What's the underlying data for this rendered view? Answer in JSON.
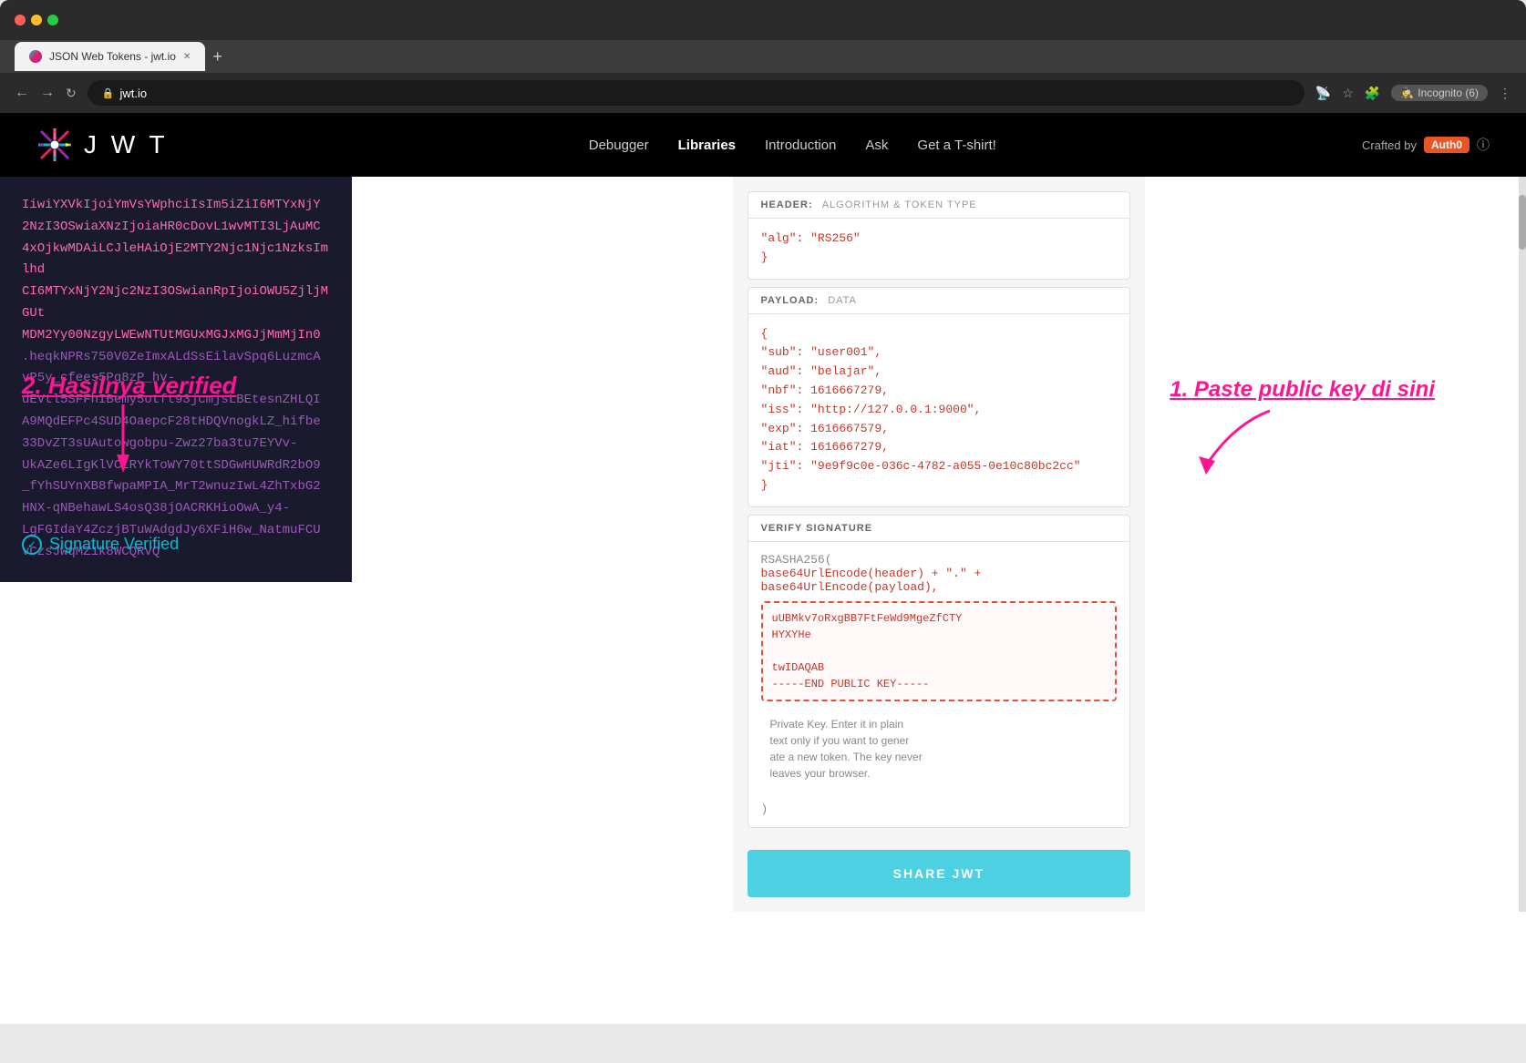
{
  "browser": {
    "tab_title": "JSON Web Tokens - jwt.io",
    "url": "jwt.io",
    "incognito_label": "Incognito (6)"
  },
  "nav": {
    "logo_text": "J W T",
    "links": [
      {
        "label": "Debugger",
        "active": false
      },
      {
        "label": "Libraries",
        "active": true
      },
      {
        "label": "Introduction",
        "active": false
      },
      {
        "label": "Ask",
        "active": false
      },
      {
        "label": "Get a T-shirt!",
        "active": false
      }
    ],
    "crafted_by": "Crafted by",
    "auth0_label": "Auth0"
  },
  "left_panel": {
    "encoded_lines": [
      "IiwiYXVkIjoiYmVsYWphciIsIm5iZiI6MTYxNjY",
      "2NzI3OSwiaXNzIjoiaHR0cDovL1wvMTI3LjAuMC",
      "4xOjkwMDAiLCJleHAiOjE2MTY2Njc1Njc1NzksImlhd",
      "CI6MTYxNjY2Njc2NzI3OSwianRpIjoiOWU5ZjljMGUt",
      "MDM2Yy00NzgyLWEwNTUtMGUxMGJxMGJjMmMjIn0",
      ".heqkNPRs750V0ZeImxALdSsEilavSpq6LuzmcA",
      "vP5y_cfees5Pg8zP_hv-",
      "dEVtl5SFFhIBemy5otft93jcmjsLBEtesnZHLQI",
      "A9MQdEFPc4SUD4OaepcF28tHDQVnogkLZ_hifbe",
      "33DvZT3sUAutowgobpu-Zwz27ba3tu7EYVv-",
      "UkAZe6LIgKlVCLRYkToWY70ttSDGwHUWRdR2bO9",
      "_fYhSUYnXB8fwpaMPIA_MrT2wnuzIwL4ZhTxbG2",
      "HNX-qNBehawLS4osQ38jOACRKHioOwA_y4-",
      "LgFGIdaY4ZczjBTuWAdgdJy6XFiH6w_NatmuFCU",
      "vCzsJwqMZ1k8WCQRVQ"
    ],
    "signature_verified_label": "Signature Verified",
    "annotation_2": "2. Hasilnya verified"
  },
  "right_panel": {
    "header_section": {
      "label": "HEADER:",
      "sublabel": "ALGORITHM & TOKEN TYPE",
      "content_lines": [
        "\"alg\": \"RS256\"",
        "}"
      ]
    },
    "payload_section": {
      "label": "PAYLOAD:",
      "sublabel": "DATA",
      "content_lines": [
        "{",
        "  \"sub\": \"user001\",",
        "  \"aud\": \"belajar\",",
        "  \"nbf\": 1616667279,",
        "  \"iss\": \"http://127.0.0.1:9000\",",
        "  \"exp\": 1616667579,",
        "  \"iat\": 1616667279,",
        "  \"jti\": \"9e9f9c0e-036c-4782-a055-0e10c80bc2cc\"",
        "}"
      ]
    },
    "verify_section": {
      "label": "VERIFY SIGNATURE",
      "function_line": "RSASHA256(",
      "param1": "base64UrlEncode(header) + \".\" +",
      "param2": "base64UrlEncode(payload),",
      "key_content": "uUBMkv7oRxgBB7FtFeWd9MgeZfCTY\nHYXYHe\n\ntwIDAQAB\n-----END PUBLIC KEY-----",
      "private_key_note": "Private Key. Enter it in plain\ntext only if you want to gener\nate a new token. The key never\nleaves your browser.",
      "closing_paren": ")"
    },
    "annotation_1": "1. Paste public key di sini",
    "share_jwt_label": "SHARE JWT"
  }
}
